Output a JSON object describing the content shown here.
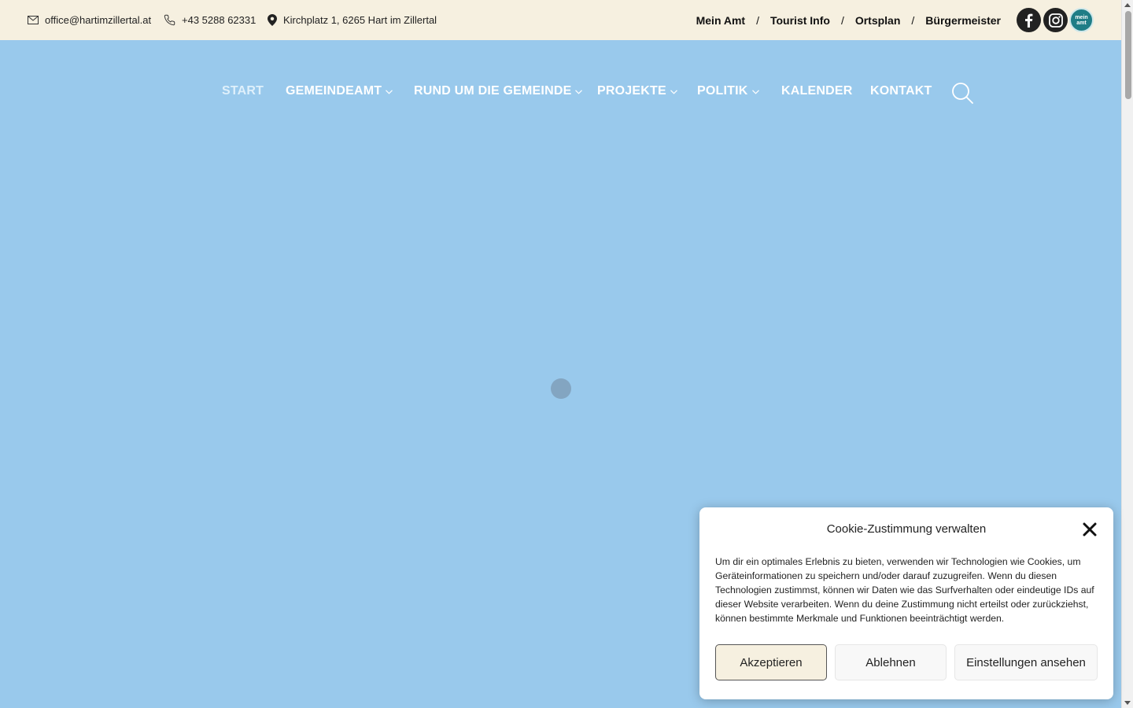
{
  "topbar": {
    "email": "office@hartimzillertal.at",
    "phone": "+43 5288 62331",
    "address": "Kirchplatz 1, 6265 Hart im Zillertal",
    "links": [
      "Mein Amt",
      "Tourist Info",
      "Ortsplan",
      "Bürgermeister"
    ],
    "separator": "/",
    "social": {
      "facebook_icon": "facebook-icon",
      "instagram_icon": "instagram-icon",
      "meinamt_icon": "mein-amt-icon",
      "meinamt_text_1": "mein",
      "meinamt_text_2": "amt"
    }
  },
  "nav": {
    "items": [
      {
        "label": "START",
        "has_dropdown": false,
        "active": true
      },
      {
        "label": "GEMEINDEAMT",
        "has_dropdown": true
      },
      {
        "label": "RUND UM DIE GEMEINDE",
        "has_dropdown": true
      },
      {
        "label": "PROJEKTE",
        "has_dropdown": true
      },
      {
        "label": "POLITIK",
        "has_dropdown": true
      },
      {
        "label": "KALENDER",
        "has_dropdown": false
      },
      {
        "label": "KONTAKT",
        "has_dropdown": false
      }
    ],
    "search_icon": "search-icon"
  },
  "cookie": {
    "title": "Cookie-Zustimmung verwalten",
    "text": "Um dir ein optimales Erlebnis zu bieten, verwenden wir Technologien wie Cookies, um Geräteinformationen zu speichern und/oder darauf zuzugreifen. Wenn du diesen Technologien zustimmst, können wir Daten wie das Surfverhalten oder eindeutige IDs auf dieser Website verarbeiten. Wenn du deine Zustimmung nicht erteilst oder zurückziehst, können bestimmte Merkmale und Funktionen beeinträchtigt werden.",
    "accept": "Akzeptieren",
    "reject": "Ablehnen",
    "settings": "Einstellungen ansehen"
  },
  "colors": {
    "topbar_bg": "#f6f0e0",
    "page_bg": "#99c9ec",
    "accent_teal": "#1f7d86"
  }
}
